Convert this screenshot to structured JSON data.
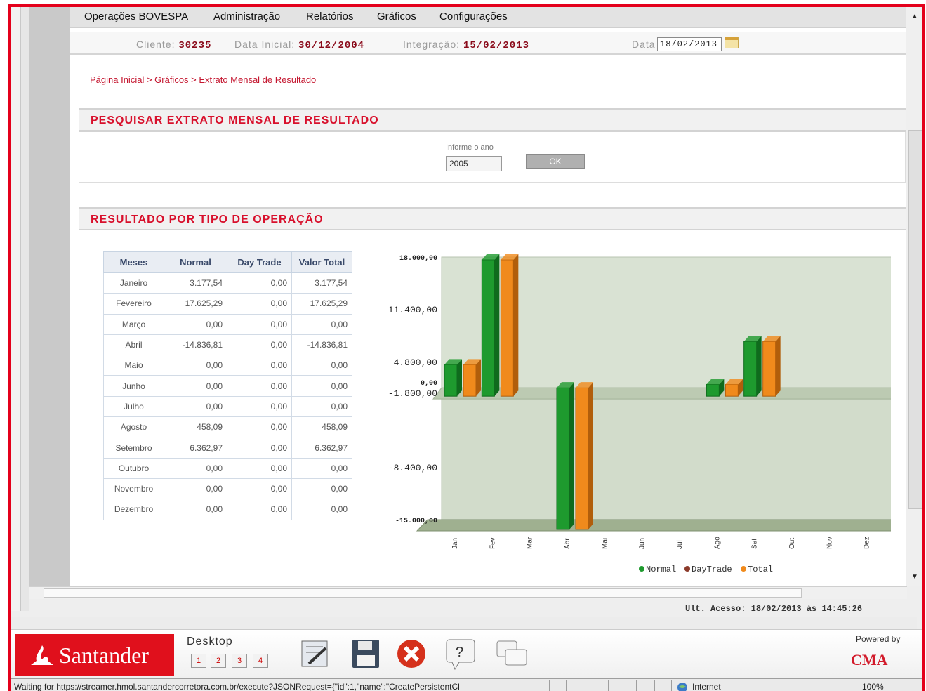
{
  "menu": [
    "Operações BOVESPA",
    "Administração",
    "Relatórios",
    "Gráficos",
    "Configurações"
  ],
  "info": {
    "cliente_label": "Cliente:",
    "cliente_value": "30235",
    "data_inicial_label": "Data Inicial:",
    "data_inicial_value": "30/12/2004",
    "integracao_label": "Integração:",
    "integracao_value": "15/02/2013",
    "data_label": "Data",
    "data_value": "18/02/2013"
  },
  "breadcrumb": "Página Inicial > Gráficos > Extrato Mensal de Resultado",
  "search": {
    "title": "PESQUISAR EXTRATO MENSAL DE RESULTADO",
    "year_label": "Informe o ano",
    "year_value": "2005",
    "ok_label": "OK"
  },
  "results": {
    "title": "RESULTADO POR TIPO DE OPERAÇÃO",
    "headers": [
      "Meses",
      "Normal",
      "Day Trade",
      "Valor Total"
    ],
    "rows": [
      [
        "Janeiro",
        "3.177,54",
        "0,00",
        "3.177,54"
      ],
      [
        "Fevereiro",
        "17.625,29",
        "0,00",
        "17.625,29"
      ],
      [
        "Março",
        "0,00",
        "0,00",
        "0,00"
      ],
      [
        "Abril",
        "-14.836,81",
        "0,00",
        "-14.836,81"
      ],
      [
        "Maio",
        "0,00",
        "0,00",
        "0,00"
      ],
      [
        "Junho",
        "0,00",
        "0,00",
        "0,00"
      ],
      [
        "Julho",
        "0,00",
        "0,00",
        "0,00"
      ],
      [
        "Agosto",
        "458,09",
        "0,00",
        "458,09"
      ],
      [
        "Setembro",
        "6.362,97",
        "0,00",
        "6.362,97"
      ],
      [
        "Outubro",
        "0,00",
        "0,00",
        "0,00"
      ],
      [
        "Novembro",
        "0,00",
        "0,00",
        "0,00"
      ],
      [
        "Dezembro",
        "0,00",
        "0,00",
        "0,00"
      ]
    ]
  },
  "chart_data": {
    "type": "bar",
    "categories": [
      "Jan",
      "Fev",
      "Mar",
      "Abr",
      "Mai",
      "Jun",
      "Jul",
      "Ago",
      "Set",
      "Out",
      "Nov",
      "Dez"
    ],
    "series": [
      {
        "name": "Normal",
        "color": "#1e9a2e",
        "values": [
          3177.54,
          17625.29,
          0,
          -14836.81,
          0,
          0,
          0,
          458.09,
          6362.97,
          0,
          0,
          0
        ]
      },
      {
        "name": "DayTrade",
        "color": "#8b3a2a",
        "values": [
          0,
          0,
          0,
          0,
          0,
          0,
          0,
          0,
          0,
          0,
          0,
          0
        ]
      },
      {
        "name": "Total",
        "color": "#f08a1c",
        "values": [
          3177.54,
          17625.29,
          0,
          -14836.81,
          0,
          0,
          0,
          458.09,
          6362.97,
          0,
          0,
          0
        ]
      }
    ],
    "yticks": [
      "18.000,00",
      "11.400,00",
      "4.800,00",
      "0,00",
      "-1.800,00",
      "-8.400,00",
      "-15.000,00"
    ],
    "ylim": [
      -15000,
      18000
    ],
    "legend": "bottom"
  },
  "taskbar": {
    "brand": "Santander",
    "desktop_label": "Desktop",
    "desktops": [
      "1",
      "2",
      "3",
      "4"
    ],
    "powered_by": "Powered by",
    "cma": "CMA"
  },
  "access_line": "Ult. Acesso: 18/02/2013 às 14:45:26",
  "status": {
    "text": "Waiting for https://streamer.hmol.santandercorretora.com.br/execute?JSONRequest={\"id\":1,\"name\":\"CreatePersistentCl",
    "zone": "Internet",
    "zoom": "100%"
  }
}
